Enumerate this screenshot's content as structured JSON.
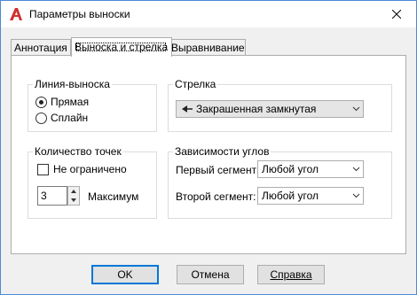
{
  "window": {
    "title": "Параметры выноски"
  },
  "tabs": [
    {
      "label": "Аннотация"
    },
    {
      "label": "Выноска и стрелка"
    },
    {
      "label": "Выравнивание"
    }
  ],
  "leader_line": {
    "title": "Линия-выноска",
    "options": [
      {
        "label": "Прямая",
        "selected": true
      },
      {
        "label": "Сплайн",
        "selected": false
      }
    ]
  },
  "arrow": {
    "title": "Стрелка",
    "value": "Закрашенная замкнутая"
  },
  "points": {
    "title": "Количество точек",
    "unlimited_label": "Не ограничено",
    "unlimited_checked": false,
    "max_value": "3",
    "max_label": "Максимум"
  },
  "angles": {
    "title": "Зависимости углов",
    "first_label": "Первый сегмент:",
    "first_value": "Любой угол",
    "second_label": "Второй сегмент:",
    "second_value": "Любой угол"
  },
  "buttons": {
    "ok": "OK",
    "cancel": "Отмена",
    "help": "Справка"
  }
}
